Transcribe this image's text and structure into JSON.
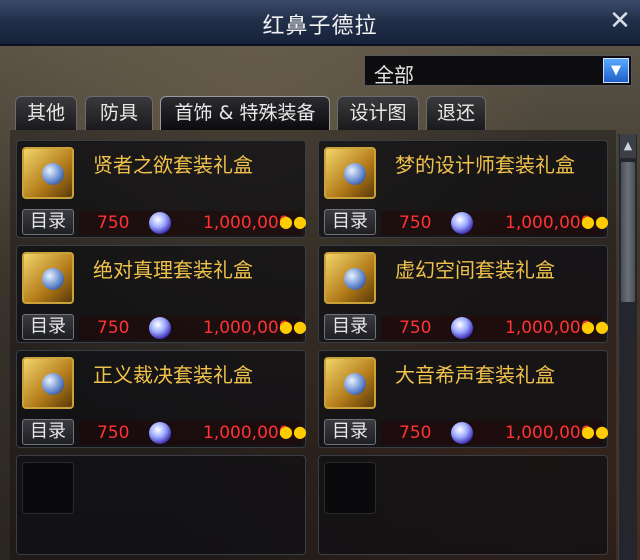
{
  "window": {
    "title": "红鼻子德拉"
  },
  "filter": {
    "selected": "全部"
  },
  "tabs": [
    {
      "label": "其他"
    },
    {
      "label": "防具"
    },
    {
      "label": "首饰 & 特殊装备"
    },
    {
      "label": "设计图"
    },
    {
      "label": "退还"
    }
  ],
  "items": [
    {
      "name": "贤者之欲套装礼盒",
      "catalog_label": "目录",
      "cera_price": "750",
      "gold_price": "1,000,000"
    },
    {
      "name": "梦的设计师套装礼盒",
      "catalog_label": "目录",
      "cera_price": "750",
      "gold_price": "1,000,000"
    },
    {
      "name": "绝对真理套装礼盒",
      "catalog_label": "目录",
      "cera_price": "750",
      "gold_price": "1,000,000"
    },
    {
      "name": "虚幻空间套装礼盒",
      "catalog_label": "目录",
      "cera_price": "750",
      "gold_price": "1,000,000"
    },
    {
      "name": "正义裁决套装礼盒",
      "catalog_label": "目录",
      "cera_price": "750",
      "gold_price": "1,000,000"
    },
    {
      "name": "大音希声套装礼盒",
      "catalog_label": "目录",
      "cera_price": "750",
      "gold_price": "1,000,000"
    }
  ],
  "icons": {
    "close": "close-icon",
    "dropdown": "chevron-down-icon",
    "cera": "cera-crystal-icon",
    "gold": "gold-coins-icon"
  }
}
